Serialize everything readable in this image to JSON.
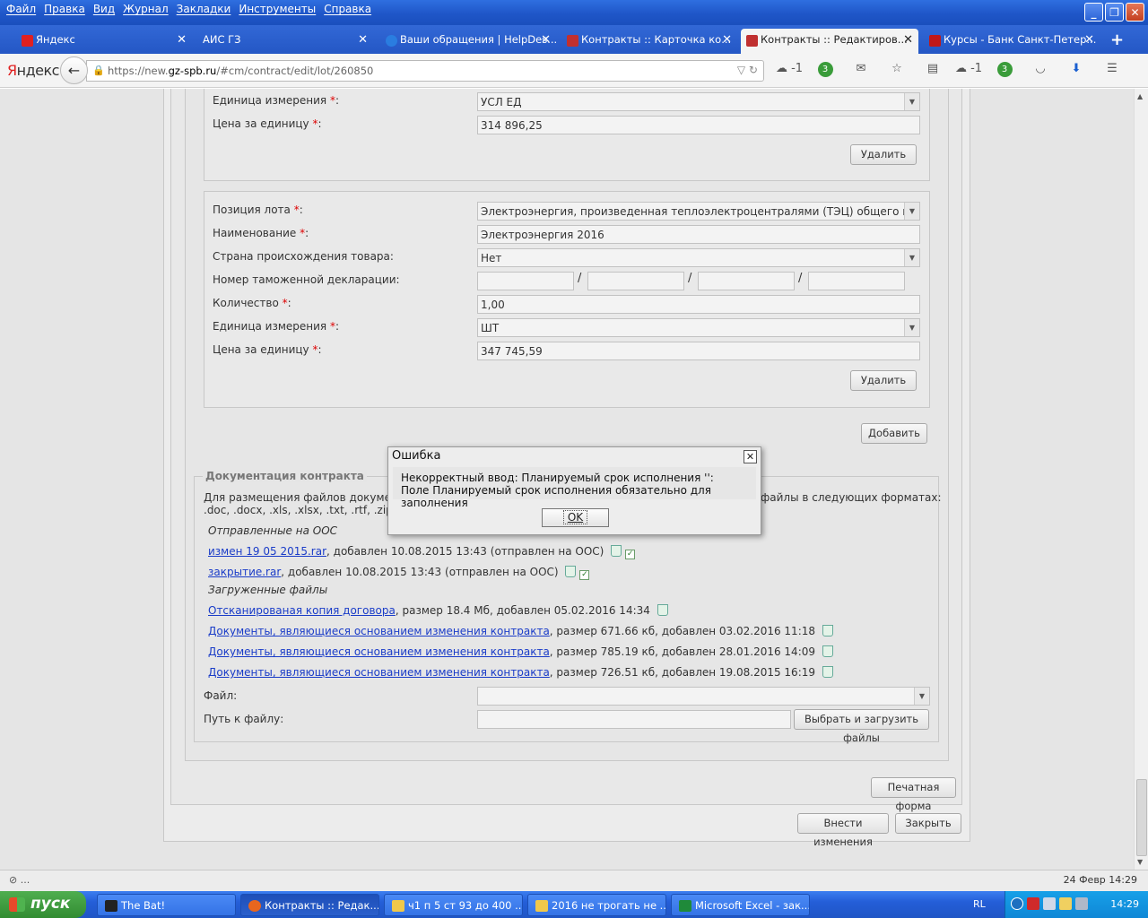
{
  "menu": [
    "Файл",
    "Правка",
    "Вид",
    "Журнал",
    "Закладки",
    "Инструменты",
    "Справка"
  ],
  "tabs": [
    {
      "label": "Яндекс",
      "icon": "yandex-icon",
      "color": "#e02020"
    },
    {
      "label": "АИС ГЗ",
      "icon": "blank-page-icon",
      "color": ""
    },
    {
      "label": "Ваши обращения | HelpDes...",
      "icon": "help-icon",
      "color": "#2a7de0"
    },
    {
      "label": "Контракты :: Карточка ко...",
      "icon": "hammer-icon",
      "color": "#c03030"
    },
    {
      "label": "Контракты :: Редактиров...",
      "icon": "hammer-icon",
      "color": "#c03030"
    },
    {
      "label": "Курсы - Банк Санкт-Петер...",
      "icon": "bank-icon",
      "color": "#c01818"
    }
  ],
  "nav": {
    "logo_prefix": "Я",
    "logo_rest": "ндекс",
    "url_prefix": "https://new.",
    "url_host": "gz-spb.ru",
    "url_rest": "/#cm/contract/edit/lot/260850",
    "cloud_count_1": "-1",
    "badge_1": "3",
    "cloud_count_2": "-1",
    "badge_2": "3"
  },
  "item1": {
    "unit_label": "Единица измерения",
    "unit_value": "УСЛ ЕД",
    "price_label": "Цена за единицу",
    "price_value": "314 896,25",
    "delete_label": "Удалить"
  },
  "item2": {
    "position_label": "Позиция лота",
    "position_value": "Электроэнергия, произведенная теплоэлектроцентралями (ТЭЦ) общего назначения",
    "name_label": "Наименование",
    "name_value": "Электроэнергия 2016",
    "country_label": "Страна происхождения товара:",
    "country_value": "Нет",
    "customs_label": "Номер таможенной декларации:",
    "qty_label": "Количество",
    "qty_value": "1,00",
    "unit_label": "Единица измерения",
    "unit_value": "ШТ",
    "price_label": "Цена за единицу",
    "price_value": "347 745,59",
    "delete_label": "Удалить"
  },
  "colon": ":",
  "asterisk": "*",
  "add_label": "Добавить",
  "docs": {
    "legend": "Документация контракта",
    "info_line1_left": "Для размещения файлов документа",
    "info_line1_right": "файлы в следующих форматах:",
    "info_line2": ".doc, .docx, .xls, .xlsx, .txt, .rtf, .zip,",
    "sent_header": "Отправленные на ООС",
    "sent": [
      {
        "name": "измен 19 05 2015.rar",
        "meta": ", добавлен 10.08.2015 13:43 (отправлен на ООС)"
      },
      {
        "name": "закрытие.rar",
        "meta": ", добавлен 10.08.2015 13:43 (отправлен на ООС)"
      }
    ],
    "uploaded_header": "Загруженные файлы",
    "uploaded": [
      {
        "name": "Отсканированая копия договора",
        "meta": ", размер 18.4 Мб, добавлен 05.02.2016 14:34"
      },
      {
        "name": "Документы, являющиеся основанием изменения контракта",
        "meta": ", размер 671.66 кб, добавлен 03.02.2016 11:18"
      },
      {
        "name": "Документы, являющиеся основанием изменения контракта",
        "meta": ", размер 785.19 кб, добавлен 28.01.2016 14:09"
      },
      {
        "name": "Документы, являющиеся основанием изменения контракта",
        "meta": ", размер 726.51 кб, добавлен 19.08.2015 16:19"
      }
    ],
    "file_label": "Файл:",
    "path_label": "Путь к файлу:",
    "upload_button": "Выбрать и загрузить файлы"
  },
  "print_button": "Печатная форма",
  "apply_button": "Внести изменения",
  "close_button": "Закрыть",
  "dialog": {
    "title": "Ошибка",
    "line1": "Некорректный ввод: Планируемый срок исполнения '':",
    "line2": "Поле Планируемый срок исполнения обязательно для заполнения",
    "ok": "OK"
  },
  "status": {
    "left": "⊘ ...",
    "right": "24 Февр 14:29"
  },
  "taskbar": {
    "start": "пуск",
    "tasks": [
      {
        "label": "The Bat!",
        "icon": "bat-icon",
        "color": "#222"
      },
      {
        "label": "Контракты :: Редак...",
        "icon": "firefox-icon",
        "color": "#e8661e"
      },
      {
        "label": "ч1 п 5 ст 93 до 400 ...",
        "icon": "folder-icon",
        "color": "#f0c84a"
      },
      {
        "label": "2016 не трогать не ...",
        "icon": "folder-icon",
        "color": "#f0c84a"
      },
      {
        "label": "Microsoft Excel - зак...",
        "icon": "excel-icon",
        "color": "#1f8a3a"
      }
    ],
    "lang": "RL",
    "clock": "14:29"
  }
}
